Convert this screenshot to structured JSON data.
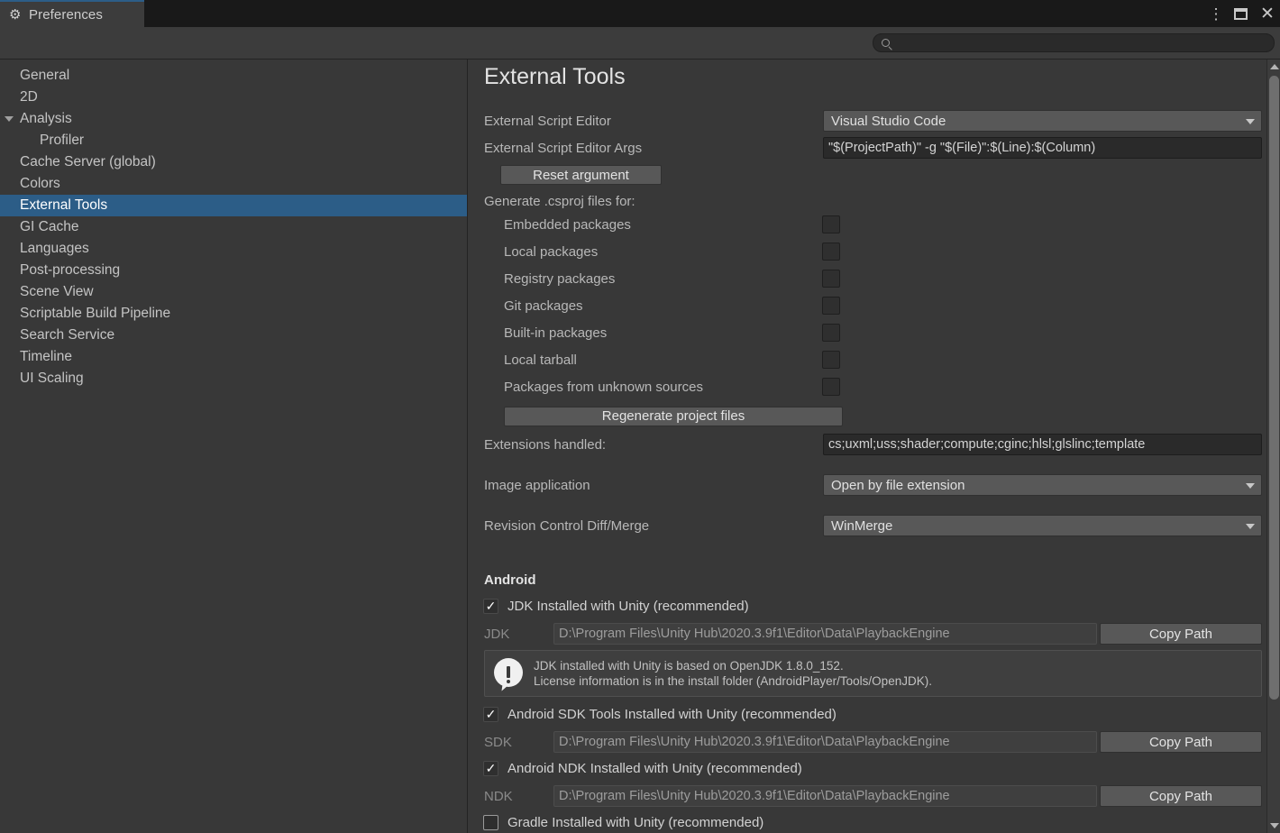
{
  "window": {
    "tab_title": "Preferences",
    "gear_icon": "gear-icon",
    "menu_icon": "⋮",
    "maximize_icon": "maximize-icon",
    "close_icon": "✕"
  },
  "search": {
    "value": "",
    "placeholder": "",
    "icon": "search-icon"
  },
  "sidebar": {
    "items": [
      {
        "label": "General",
        "indent": false,
        "triangle": false,
        "selected": false
      },
      {
        "label": "2D",
        "indent": false,
        "triangle": false,
        "selected": false
      },
      {
        "label": "Analysis",
        "indent": false,
        "triangle": true,
        "selected": false
      },
      {
        "label": "Profiler",
        "indent": true,
        "triangle": false,
        "selected": false
      },
      {
        "label": "Cache Server (global)",
        "indent": false,
        "triangle": false,
        "selected": false
      },
      {
        "label": "Colors",
        "indent": false,
        "triangle": false,
        "selected": false
      },
      {
        "label": "External Tools",
        "indent": false,
        "triangle": false,
        "selected": true
      },
      {
        "label": "GI Cache",
        "indent": false,
        "triangle": false,
        "selected": false
      },
      {
        "label": "Languages",
        "indent": false,
        "triangle": false,
        "selected": false
      },
      {
        "label": "Post-processing",
        "indent": false,
        "triangle": false,
        "selected": false
      },
      {
        "label": "Scene View",
        "indent": false,
        "triangle": false,
        "selected": false
      },
      {
        "label": "Scriptable Build Pipeline",
        "indent": false,
        "triangle": false,
        "selected": false
      },
      {
        "label": "Search Service",
        "indent": false,
        "triangle": false,
        "selected": false
      },
      {
        "label": "Timeline",
        "indent": false,
        "triangle": false,
        "selected": false
      },
      {
        "label": "UI Scaling",
        "indent": false,
        "triangle": false,
        "selected": false
      }
    ]
  },
  "main": {
    "title": "External Tools",
    "script_editor": {
      "label": "External Script Editor",
      "value": "Visual Studio Code"
    },
    "script_editor_args": {
      "label": "External Script Editor Args",
      "value": "\"$(ProjectPath)\" -g \"$(File)\":$(Line):$(Column)"
    },
    "reset_argument_button": "Reset argument",
    "csproj": {
      "heading": "Generate .csproj files for:",
      "options": [
        {
          "label": "Embedded packages",
          "checked": false
        },
        {
          "label": "Local packages",
          "checked": false
        },
        {
          "label": "Registry packages",
          "checked": false
        },
        {
          "label": "Git packages",
          "checked": false
        },
        {
          "label": "Built-in packages",
          "checked": false
        },
        {
          "label": "Local tarball",
          "checked": false
        },
        {
          "label": "Packages from unknown sources",
          "checked": false
        }
      ],
      "regenerate_button": "Regenerate project files"
    },
    "extensions": {
      "label": "Extensions handled:",
      "value": "cs;uxml;uss;shader;compute;cginc;hlsl;glslinc;template"
    },
    "image_application": {
      "label": "Image application",
      "value": "Open by file extension"
    },
    "diff_merge": {
      "label": "Revision Control Diff/Merge",
      "value": "WinMerge"
    },
    "android": {
      "heading": "Android",
      "jdk_toggle": {
        "label": "JDK Installed with Unity (recommended)",
        "checked": true
      },
      "jdk_path": {
        "label": "JDK",
        "value": "D:\\Program Files\\Unity Hub\\2020.3.9f1\\Editor\\Data\\PlaybackEngine",
        "button": "Copy Path"
      },
      "jdk_info": {
        "icon": "info-exclamation-icon",
        "line1": "JDK installed with Unity is based on OpenJDK 1.8.0_152.",
        "line2": "License information is in the install folder (AndroidPlayer/Tools/OpenJDK)."
      },
      "sdk_toggle": {
        "label": "Android SDK Tools Installed with Unity (recommended)",
        "checked": true
      },
      "sdk_path": {
        "label": "SDK",
        "value": "D:\\Program Files\\Unity Hub\\2020.3.9f1\\Editor\\Data\\PlaybackEngine",
        "button": "Copy Path"
      },
      "ndk_toggle": {
        "label": "Android NDK Installed with Unity (recommended)",
        "checked": true
      },
      "ndk_path": {
        "label": "NDK",
        "value": "D:\\Program Files\\Unity Hub\\2020.3.9f1\\Editor\\Data\\PlaybackEngine",
        "button": "Copy Path"
      },
      "gradle_toggle": {
        "label": "Gradle Installed with Unity (recommended)",
        "checked": false
      }
    }
  },
  "colors": {
    "accent": "#2c5d87",
    "background": "#383838",
    "titlebar": "#191919",
    "field": "#2a2a2a",
    "control": "#585858"
  }
}
